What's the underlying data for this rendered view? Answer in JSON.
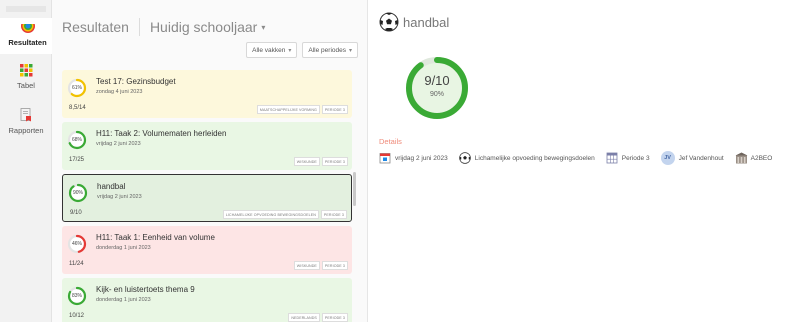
{
  "rail": {
    "items": [
      {
        "label": "Resultaten",
        "icon": "results-rainbow-icon"
      },
      {
        "label": "Tabel",
        "icon": "grid-icon"
      },
      {
        "label": "Rapporten",
        "icon": "report-icon"
      }
    ]
  },
  "list": {
    "title": "Resultaten",
    "year_selector": "Huidig schooljaar",
    "caret": "▾",
    "filters": [
      {
        "label": "Alle vakken",
        "caret": "▾"
      },
      {
        "label": "Alle periodes",
        "caret": "▾"
      }
    ],
    "cards": [
      {
        "pct": "61%",
        "fraction": 0.61,
        "status": "yellow",
        "title": "Test 17: Gezinsbudget",
        "date": "zondag 4 juni 2023",
        "score": "8,5/14",
        "tags": [
          "Maatschappelijke vorming",
          "Periode 3"
        ]
      },
      {
        "pct": "68%",
        "fraction": 0.68,
        "status": "green",
        "title": "H11: Taak 2: Volumematen herleiden",
        "date": "vrijdag 2 juni 2023",
        "score": "17/25",
        "tags": [
          "Wiskunde",
          "Periode 3"
        ]
      },
      {
        "pct": "90%",
        "fraction": 0.9,
        "status": "selected",
        "title": "handbal",
        "date": "vrijdag 2 juni 2023",
        "score": "9/10",
        "tags": [
          "Lichamelijke opvoeding bewegingsdoelen",
          "Periode 3"
        ]
      },
      {
        "pct": "46%",
        "fraction": 0.46,
        "status": "red",
        "title": "H11: Taak 1: Eenheid van volume",
        "date": "donderdag 1 juni 2023",
        "score": "11/24",
        "tags": [
          "Wiskunde",
          "Periode 3"
        ]
      },
      {
        "pct": "83%",
        "fraction": 0.83,
        "status": "green",
        "title": "Kijk- en luistertoets thema 9",
        "date": "donderdag 1 juni 2023",
        "score": "10/12",
        "tags": [
          "Nederlands",
          "Periode 3"
        ]
      }
    ]
  },
  "detail": {
    "title": "handbal",
    "icon": "soccer-ball-icon",
    "score": "9/10",
    "pct": "90%",
    "fraction": 0.9,
    "details_label": "Details",
    "chips": [
      {
        "icon": "calendar-icon",
        "label": "vrijdag 2 juni 2023"
      },
      {
        "icon": "soccer-ball-icon",
        "label": "Lichamelijke opvoeding bewegingsdoelen"
      },
      {
        "icon": "calendar-grid-icon",
        "label": "Periode 3"
      },
      {
        "icon": "avatar",
        "initials": "JV",
        "label": "Jef Vandenhout"
      },
      {
        "icon": "building-icon",
        "label": "A2BEO"
      }
    ]
  },
  "colors": {
    "green": "#3aaa35",
    "yellow": "#f2c200",
    "red": "#e53935",
    "details_label": "#ef8b7a"
  }
}
